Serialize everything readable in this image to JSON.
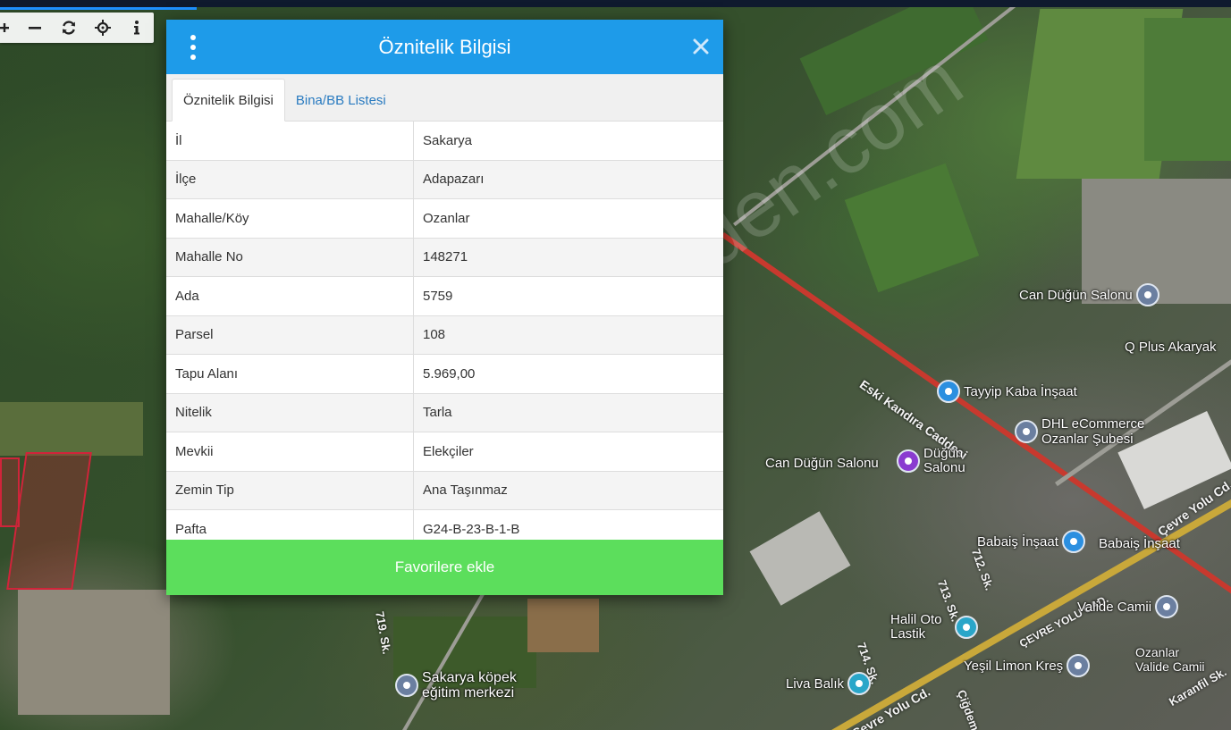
{
  "toolbar": {
    "icons": [
      "plus-icon",
      "minus-icon",
      "refresh-icon",
      "crosshair-icon",
      "info-icon"
    ]
  },
  "dialog": {
    "title": "Öznitelik Bilgisi",
    "tabs": [
      {
        "label": "Öznitelik Bilgisi",
        "active": true
      },
      {
        "label": "Bina/BB Listesi",
        "active": false
      }
    ],
    "rows": [
      {
        "key": "İl",
        "value": "Sakarya"
      },
      {
        "key": "İlçe",
        "value": "Adapazarı"
      },
      {
        "key": "Mahalle/Köy",
        "value": "Ozanlar"
      },
      {
        "key": "Mahalle No",
        "value": "148271"
      },
      {
        "key": "Ada",
        "value": "5759"
      },
      {
        "key": "Parsel",
        "value": "108"
      },
      {
        "key": "Tapu Alanı",
        "value": "5.969,00"
      },
      {
        "key": "Nitelik",
        "value": "Tarla"
      },
      {
        "key": "Mevkii",
        "value": "Elekçiler"
      },
      {
        "key": "Zemin Tip",
        "value": "Ana Taşınmaz"
      },
      {
        "key": "Pafta",
        "value": "G24-B-23-B-1-B"
      }
    ],
    "favorite_label": "Favorilere ekle",
    "accent": "#1e9be9",
    "button_color": "#5cde5c"
  },
  "map": {
    "places": [
      "Can Düğün Salonu",
      "Q Plus Akaryak",
      "Tayyip Kaba İnşaat",
      "DHL eCommerce Ozanlar Şubesi",
      "Düğün Salonu",
      "Can Düğün Salonu",
      "Babaiş İnşaat",
      "Babaiş İnşaat",
      "Valide Camii",
      "Halil Oto Lastik",
      "Yeşil Limon Kreş",
      "Ozanlar Valide Camii",
      "Liva Balık",
      "Sakarya köpek eğitim merkezi"
    ],
    "streets": [
      "Eski Kandıra Caddesi",
      "Çevre Yolu Cd.",
      "ÇEVRE YOLU CAD.",
      "Çevre Yolu Cd.",
      "712. Sk.",
      "713. Sk.",
      "714. Sk.",
      "719. Sk.",
      "Karanfil Sk.",
      "Çiğdem"
    ],
    "watermark": "sahibinden.com"
  }
}
